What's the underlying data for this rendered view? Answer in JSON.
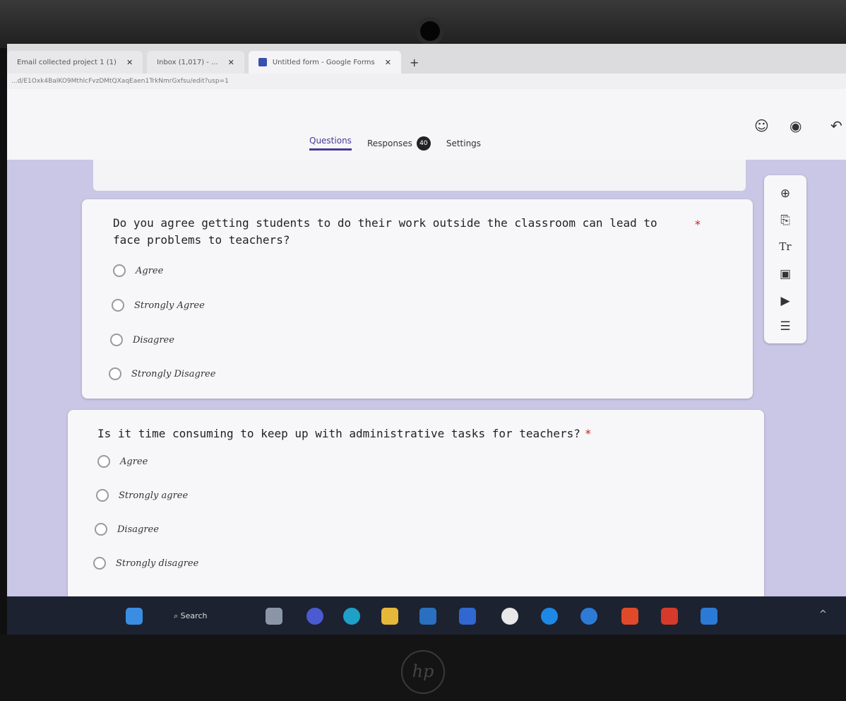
{
  "browser": {
    "tabs": [
      {
        "label": "Email collected project 1 (1)"
      },
      {
        "label": "Inbox (1,017) - ..."
      },
      {
        "label": "Untitled form - Google Forms"
      }
    ],
    "new_tab": "+",
    "url": "...d/E1Oxk4BaIKO9MthlcFvzDMtQXaqEaen1TrkNmrGxfsu/edit?usp=1"
  },
  "header": {
    "tabs": {
      "questions": "Questions",
      "responses": "Responses",
      "responses_count": "40",
      "settings": "Settings"
    },
    "icons": [
      "palette-icon",
      "preview-icon",
      "undo-icon"
    ]
  },
  "questions": [
    {
      "title": "Do you agree getting students to do their work outside the classroom can lead to face problems to teachers?",
      "required_mark": "*",
      "options": [
        "Agree",
        "Strongly Agree",
        "Disagree",
        "Strongly Disagree"
      ]
    },
    {
      "title": "Is it time consuming to keep up with administrative tasks for teachers?",
      "required_mark": "*",
      "options": [
        "Agree",
        "Strongly agree",
        "Disagree",
        "Strongly disagree"
      ]
    }
  ],
  "toolbar": {
    "items": [
      "add-question-icon",
      "import-questions-icon",
      "add-title-icon",
      "add-image-icon",
      "add-video-icon",
      "add-section-icon"
    ],
    "title_glyph": "Tr"
  },
  "taskbar": {
    "search_label": "Search",
    "tray": "^"
  },
  "device": {
    "logo_text": "hp"
  },
  "colors": {
    "accent": "#4b3a93",
    "background": "#c9c6e6",
    "card": "#f7f7f9"
  }
}
